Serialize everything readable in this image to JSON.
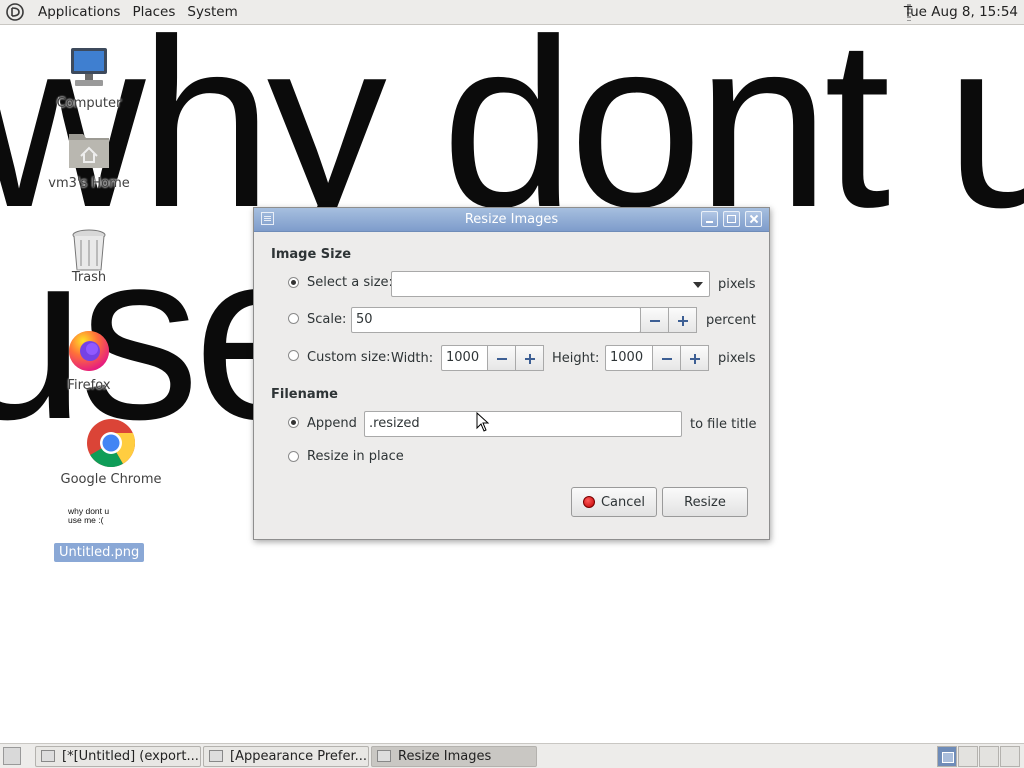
{
  "top_panel": {
    "menus": [
      "Applications",
      "Places",
      "System"
    ],
    "clock": "Tue Aug  8, 15:54"
  },
  "desktop": {
    "background_text": {
      "line1": "why dont u",
      "line2": "use"
    },
    "icons": [
      {
        "label": "Computer",
        "icon": "computer-icon"
      },
      {
        "label": "vm3's Home",
        "icon": "home-folder-icon"
      },
      {
        "label": "Trash",
        "icon": "trash-icon"
      },
      {
        "label": "Firefox",
        "icon": "firefox-icon"
      },
      {
        "label": "Google Chrome",
        "icon": "chrome-icon"
      }
    ],
    "file_thumbnail_text": "why dont u\nuse me :(",
    "selected_file_label": "Untitled.png"
  },
  "dialog": {
    "title": "Resize Images",
    "image_size": {
      "heading": "Image Size",
      "select_size_label": "Select a size:",
      "select_size_value": "",
      "select_size_unit": "pixels",
      "scale_label": "Scale:",
      "scale_value": "50",
      "scale_unit": "percent",
      "custom_size_label": "Custom size:",
      "width_label": "Width:",
      "width_value": "1000",
      "height_label": "Height:",
      "height_value": "1000",
      "custom_unit": "pixels",
      "selected_option": "select_size"
    },
    "filename": {
      "heading": "Filename",
      "append_label": "Append",
      "append_value": ".resized",
      "append_suffix": "to file title",
      "resize_in_place_label": "Resize in place",
      "selected_option": "append"
    },
    "buttons": {
      "cancel": "Cancel",
      "resize": "Resize"
    }
  },
  "taskbar": {
    "tasks": [
      {
        "label": "[*[Untitled] (export..."
      },
      {
        "label": "[Appearance Prefer..."
      },
      {
        "label": "Resize Images",
        "active": true
      }
    ],
    "workspaces": 4,
    "active_workspace": 1
  },
  "colors": {
    "titlebar": "#8aa8d6",
    "selection": "#8aa8d6",
    "panel": "#edecea"
  }
}
